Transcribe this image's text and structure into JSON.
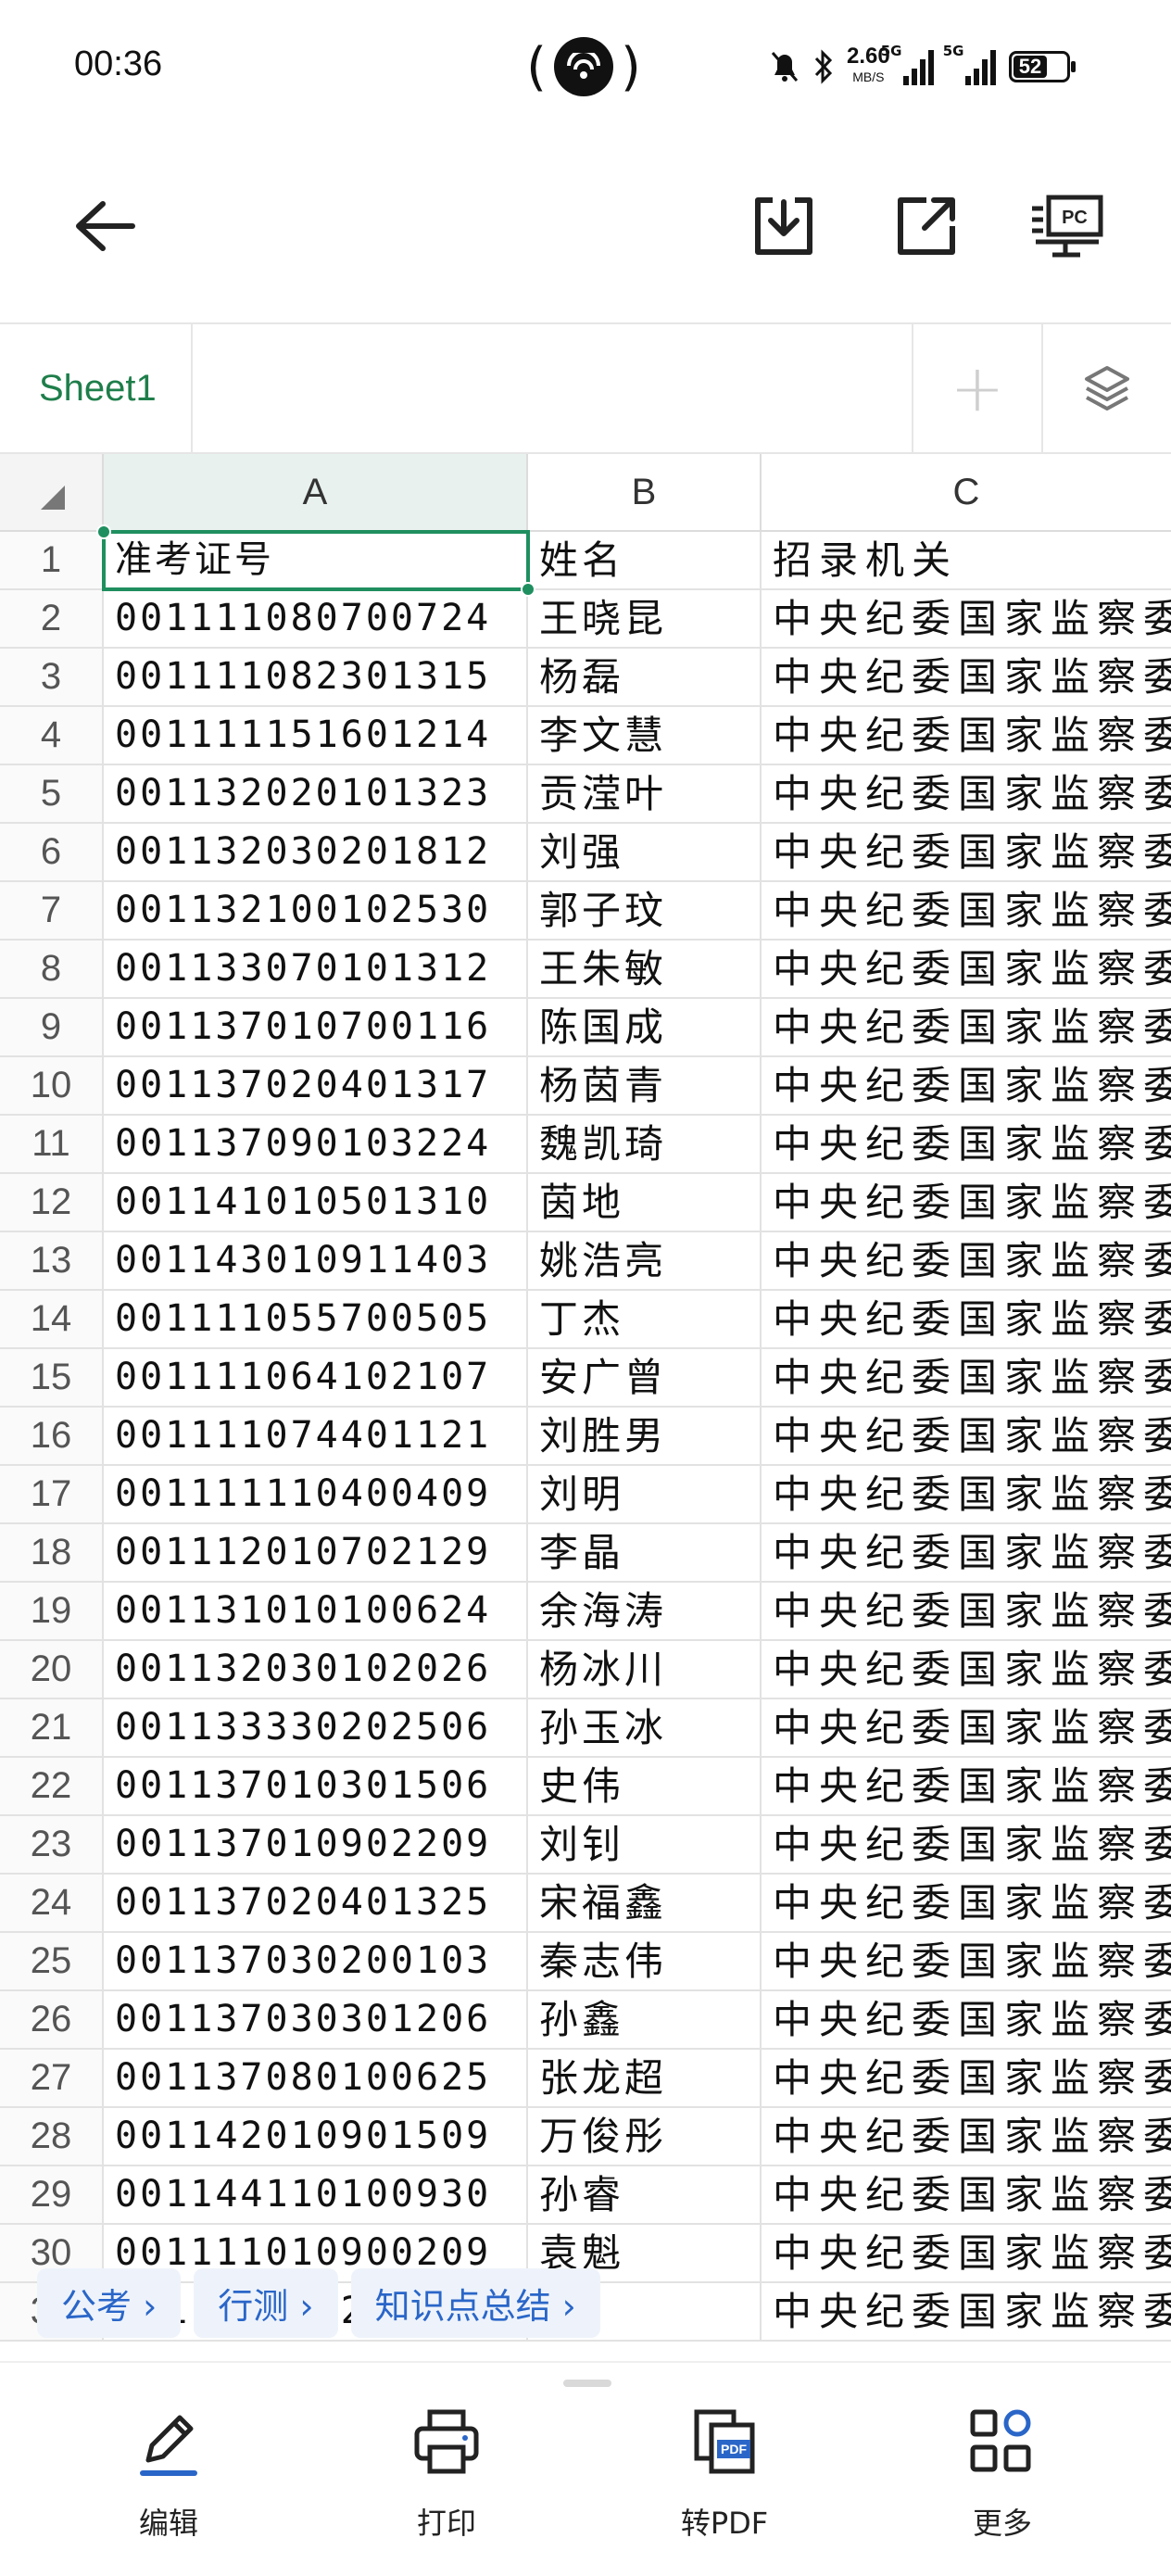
{
  "status": {
    "time": "00:36",
    "network_speed": "2.60",
    "network_unit": "MB/S",
    "sim1_label": "5G",
    "sim2_label": "5G",
    "battery": "52"
  },
  "toolbar": {
    "icons": [
      "back-arrow-icon",
      "download-icon",
      "share-icon",
      "pc-display-icon"
    ]
  },
  "sheet": {
    "tab_name": "Sheet1",
    "add_label": "+"
  },
  "columns": [
    "A",
    "B",
    "C"
  ],
  "colors": {
    "accent": "#1f8f5f",
    "chip_text": "#2a66c8"
  },
  "rows": [
    {
      "n": "1",
      "a": "准考证号",
      "b": "姓名",
      "c": "招录机关"
    },
    {
      "n": "2",
      "a": "001111080700724",
      "b": "王晓昆",
      "c": "中央纪委国家监察委"
    },
    {
      "n": "3",
      "a": "001111082301315",
      "b": "杨磊",
      "c": "中央纪委国家监察委"
    },
    {
      "n": "4",
      "a": "001111151601214",
      "b": "李文慧",
      "c": "中央纪委国家监察委"
    },
    {
      "n": "5",
      "a": "001132020101323",
      "b": "贡滢叶",
      "c": "中央纪委国家监察委"
    },
    {
      "n": "6",
      "a": "001132030201812",
      "b": "刘强",
      "c": "中央纪委国家监察委"
    },
    {
      "n": "7",
      "a": "001132100102530",
      "b": "郭子玟",
      "c": "中央纪委国家监察委"
    },
    {
      "n": "8",
      "a": "001133070101312",
      "b": "王朱敏",
      "c": "中央纪委国家监察委"
    },
    {
      "n": "9",
      "a": "001137010700116",
      "b": "陈国成",
      "c": "中央纪委国家监察委"
    },
    {
      "n": "10",
      "a": "001137020401317",
      "b": "杨茵青",
      "c": "中央纪委国家监察委"
    },
    {
      "n": "11",
      "a": "001137090103224",
      "b": "魏凯琦",
      "c": "中央纪委国家监察委"
    },
    {
      "n": "12",
      "a": "001141010501310",
      "b": "茵地",
      "c": "中央纪委国家监察委"
    },
    {
      "n": "13",
      "a": "001143010911403",
      "b": "姚浩亮",
      "c": "中央纪委国家监察委"
    },
    {
      "n": "14",
      "a": "001111055700505",
      "b": "丁杰",
      "c": "中央纪委国家监察委"
    },
    {
      "n": "15",
      "a": "001111064102107",
      "b": "安广曾",
      "c": "中央纪委国家监察委"
    },
    {
      "n": "16",
      "a": "001111074401121",
      "b": "刘胜男",
      "c": "中央纪委国家监察委"
    },
    {
      "n": "17",
      "a": "001111110400409",
      "b": "刘明",
      "c": "中央纪委国家监察委"
    },
    {
      "n": "18",
      "a": "001112010702129",
      "b": "李晶",
      "c": "中央纪委国家监察委"
    },
    {
      "n": "19",
      "a": "001131010100624",
      "b": "余海涛",
      "c": "中央纪委国家监察委"
    },
    {
      "n": "20",
      "a": "001132030102026",
      "b": "杨冰川",
      "c": "中央纪委国家监察委"
    },
    {
      "n": "21",
      "a": "001133330202506",
      "b": "孙玉冰",
      "c": "中央纪委国家监察委"
    },
    {
      "n": "22",
      "a": "001137010301506",
      "b": "史伟",
      "c": "中央纪委国家监察委"
    },
    {
      "n": "23",
      "a": "001137010902209",
      "b": "刘钊",
      "c": "中央纪委国家监察委"
    },
    {
      "n": "24",
      "a": "001137020401325",
      "b": "宋福鑫",
      "c": "中央纪委国家监察委"
    },
    {
      "n": "25",
      "a": "001137030200103",
      "b": "秦志伟",
      "c": "中央纪委国家监察委"
    },
    {
      "n": "26",
      "a": "001137030301206",
      "b": "孙鑫",
      "c": "中央纪委国家监察委"
    },
    {
      "n": "27",
      "a": "001137080100625",
      "b": "张龙超",
      "c": "中央纪委国家监察委"
    },
    {
      "n": "28",
      "a": "001142010901509",
      "b": "万俊彤",
      "c": "中央纪委国家监察委"
    },
    {
      "n": "29",
      "a": "001144110100930",
      "b": "孙睿",
      "c": "中央纪委国家监察委"
    },
    {
      "n": "30",
      "a": "001111010900209",
      "b": "袁魁",
      "c": "中央纪委国家监察委"
    },
    {
      "n": "31",
      "a": "001111020200108",
      "b": "",
      "c": "中央纪委国家监察委"
    }
  ],
  "chips": [
    "公考 ›",
    "行测 ›",
    "知识点总结 ›"
  ],
  "bottom_bar": [
    {
      "label": "编辑",
      "icon": "pencil-icon"
    },
    {
      "label": "打印",
      "icon": "printer-icon"
    },
    {
      "label": "转PDF",
      "icon": "pdf-convert-icon",
      "icon_text": "PDF"
    },
    {
      "label": "更多",
      "icon": "more-apps-icon"
    }
  ]
}
